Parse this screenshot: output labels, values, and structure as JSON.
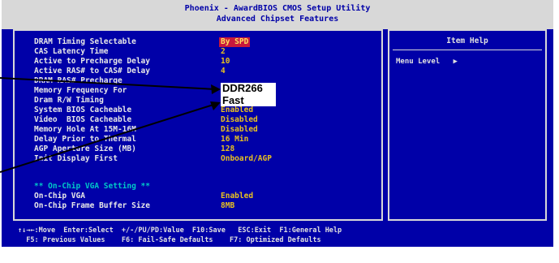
{
  "header": {
    "title": "Phoenix - AwardBIOS CMOS Setup Utility",
    "subtitle": "Advanced Chipset Features"
  },
  "settings": [
    {
      "label": "DRAM Timing Selectable",
      "value": "By SPD",
      "selected": true
    },
    {
      "label": "CAS Latency Time",
      "value": "2"
    },
    {
      "label": "Active to Precharge Delay",
      "value": "10"
    },
    {
      "label": "Active RAS# to CAS# Delay",
      "value": "4"
    },
    {
      "label": "DRAM RAS# Precharge",
      "value": ""
    },
    {
      "label": "Memory Frequency For",
      "value": ""
    },
    {
      "label": "Dram R/W Timing",
      "value": ""
    },
    {
      "label": "System BIOS Cacheable",
      "value": "Enabled"
    },
    {
      "label": "Video  BIOS Cacheable",
      "value": "Disabled"
    },
    {
      "label": "Memory Hole At 15M-16M",
      "value": "Disabled"
    },
    {
      "label": "Delay Prior to Thermal",
      "value": "16 Min"
    },
    {
      "label": "AGP Aperture Size (MB)",
      "value": "128"
    },
    {
      "label": "Init Display First",
      "value": "Onboard/AGP"
    }
  ],
  "onchip_header": "** On-Chip VGA Setting **",
  "onchip_settings": [
    {
      "label": "On-Chip VGA",
      "value": "Enabled"
    },
    {
      "label": "On-Chip Frame Buffer Size",
      "value": "8MB"
    }
  ],
  "help": {
    "title": "Item Help",
    "menu_level": "Menu Level   ▶"
  },
  "footer": {
    "line1": "↑↓→←:Move  Enter:Select  +/-/PU/PD:Value  F10:Save   ESC:Exit  F1:General Help",
    "line2": "  F5: Previous Values    F6: Fail-Safe Defaults    F7: Optimized Defaults"
  },
  "callouts": {
    "value1": "DDR266",
    "value2": "Fast"
  },
  "colors": {
    "background": "#0000a8",
    "header_bg": "#d8d8d8",
    "label": "#e8e8e8",
    "value": "#e8c020",
    "selected_bg": "#c8183c",
    "comment": "#00c8c8"
  }
}
